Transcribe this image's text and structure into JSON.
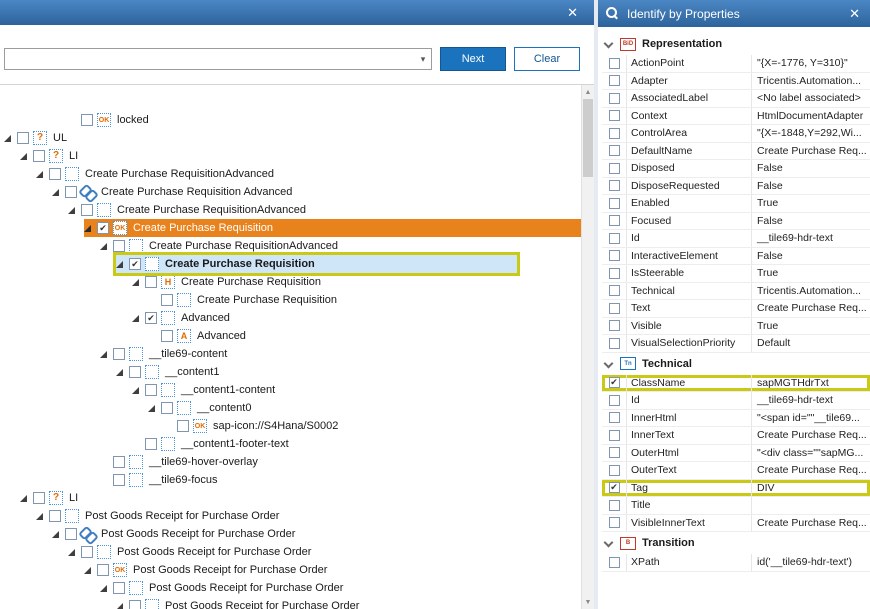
{
  "icons": {
    "close": "✕",
    "combo_arrow": "▾",
    "scroll_up": "▲",
    "scroll_down": "▼"
  },
  "left_panel": {
    "search": {
      "value": "",
      "next_label": "Next",
      "clear_label": "Clear"
    },
    "tree": [
      {
        "indent": 4,
        "arrow": false,
        "checked": false,
        "icon": "ok",
        "label": "locked"
      },
      {
        "indent": 0,
        "arrow": true,
        "checked": false,
        "icon": "question",
        "label": "UL"
      },
      {
        "indent": 1,
        "arrow": true,
        "checked": false,
        "icon": "question",
        "label": "LI"
      },
      {
        "indent": 2,
        "arrow": true,
        "checked": false,
        "icon": "dotted",
        "label": "Create Purchase RequisitionAdvanced"
      },
      {
        "indent": 3,
        "arrow": true,
        "checked": false,
        "icon": "link",
        "label": "Create Purchase Requisition Advanced"
      },
      {
        "indent": 4,
        "arrow": true,
        "checked": false,
        "icon": "dotted",
        "label": "Create Purchase RequisitionAdvanced"
      },
      {
        "indent": 5,
        "arrow": true,
        "checked": true,
        "icon": "ok",
        "label": "Create Purchase Requisition",
        "style": "row-orange"
      },
      {
        "indent": 6,
        "arrow": true,
        "checked": false,
        "icon": "dotted",
        "label": "Create Purchase RequisitionAdvanced"
      },
      {
        "indent": 7,
        "arrow": true,
        "checked": true,
        "icon": "dotted",
        "label": "Create Purchase Requisition",
        "style": "yellow-selected"
      },
      {
        "indent": 8,
        "arrow": true,
        "checked": false,
        "icon": "h",
        "label": "Create Purchase Requisition"
      },
      {
        "indent": 9,
        "arrow": false,
        "checked": false,
        "icon": "dotted",
        "label": "Create Purchase Requisition"
      },
      {
        "indent": 8,
        "arrow": true,
        "checked": true,
        "icon": "dotted",
        "label": "Advanced"
      },
      {
        "indent": 9,
        "arrow": false,
        "checked": false,
        "icon": "a",
        "label": "Advanced"
      },
      {
        "indent": 6,
        "arrow": true,
        "checked": false,
        "icon": "dotted",
        "label": "__tile69-content"
      },
      {
        "indent": 7,
        "arrow": true,
        "checked": false,
        "icon": "dotted",
        "label": "__content1"
      },
      {
        "indent": 8,
        "arrow": true,
        "checked": false,
        "icon": "dotted",
        "label": "__content1-content"
      },
      {
        "indent": 9,
        "arrow": true,
        "checked": false,
        "icon": "dotted",
        "label": "__content0"
      },
      {
        "indent": 10,
        "arrow": false,
        "checked": false,
        "icon": "ok",
        "label": "sap-icon://S4Hana/S0002"
      },
      {
        "indent": 8,
        "arrow": false,
        "checked": false,
        "icon": "dotted",
        "label": "__content1-footer-text"
      },
      {
        "indent": 6,
        "arrow": false,
        "checked": false,
        "icon": "dotted",
        "label": "__tile69-hover-overlay"
      },
      {
        "indent": 6,
        "arrow": false,
        "checked": false,
        "icon": "dotted",
        "label": "__tile69-focus"
      },
      {
        "indent": 1,
        "arrow": true,
        "checked": false,
        "icon": "question",
        "label": "LI"
      },
      {
        "indent": 2,
        "arrow": true,
        "checked": false,
        "icon": "dotted",
        "label": "Post Goods Receipt for Purchase Order"
      },
      {
        "indent": 3,
        "arrow": true,
        "checked": false,
        "icon": "link",
        "label": "Post Goods Receipt for Purchase Order"
      },
      {
        "indent": 4,
        "arrow": true,
        "checked": false,
        "icon": "dotted",
        "label": "Post Goods Receipt for Purchase Order"
      },
      {
        "indent": 5,
        "arrow": true,
        "checked": false,
        "icon": "ok",
        "label": "Post Goods Receipt for Purchase Order"
      },
      {
        "indent": 6,
        "arrow": true,
        "checked": false,
        "icon": "dotted",
        "label": "Post Goods Receipt for Purchase Order"
      },
      {
        "indent": 7,
        "arrow": true,
        "checked": false,
        "icon": "dotted",
        "label": "Post Goods Receipt for Purchase Order"
      }
    ]
  },
  "right_panel": {
    "title": "Identify by Properties",
    "sections": [
      {
        "title": "Representation",
        "icon_text": "BiD",
        "icon_color": "#c0392b",
        "rows": [
          {
            "name": "ActionPoint",
            "value": "\"{X=-1776, Y=310}\"",
            "checked": false
          },
          {
            "name": "Adapter",
            "value": "Tricentis.Automation...",
            "checked": false
          },
          {
            "name": "AssociatedLabel",
            "value": "<No label associated>",
            "checked": false
          },
          {
            "name": "Context",
            "value": "HtmlDocumentAdapter",
            "checked": false
          },
          {
            "name": "ControlArea",
            "value": "\"{X=-1848,Y=292,Wi...",
            "checked": false
          },
          {
            "name": "DefaultName",
            "value": "Create Purchase Req...",
            "checked": false
          },
          {
            "name": "Disposed",
            "value": "False",
            "checked": false
          },
          {
            "name": "DisposeRequested",
            "value": "False",
            "checked": false
          },
          {
            "name": "Enabled",
            "value": "True",
            "checked": false
          },
          {
            "name": "Focused",
            "value": "False",
            "checked": false
          },
          {
            "name": "Id",
            "value": "__tile69-hdr-text",
            "checked": false
          },
          {
            "name": "InteractiveElement",
            "value": "False",
            "checked": false
          },
          {
            "name": "IsSteerable",
            "value": "True",
            "checked": false
          },
          {
            "name": "Technical",
            "value": "Tricentis.Automation...",
            "checked": false
          },
          {
            "name": "Text",
            "value": "Create Purchase Req...",
            "checked": false
          },
          {
            "name": "Visible",
            "value": "True",
            "checked": false
          },
          {
            "name": "VisualSelectionPriority",
            "value": "Default",
            "checked": false
          }
        ]
      },
      {
        "title": "Technical",
        "icon_text": "Tn",
        "icon_color": "#1b72bd",
        "rows": [
          {
            "name": "ClassName",
            "value": "sapMGTHdrTxt",
            "checked": true,
            "highlight": true
          },
          {
            "name": "Id",
            "value": "__tile69-hdr-text",
            "checked": false
          },
          {
            "name": "InnerHtml",
            "value": "\"<span id=\"\"__tile69...",
            "checked": false
          },
          {
            "name": "InnerText",
            "value": "Create Purchase Req...",
            "checked": false
          },
          {
            "name": "OuterHtml",
            "value": "\"<div class=\"\"sapMG...",
            "checked": false
          },
          {
            "name": "OuterText",
            "value": "Create Purchase Req...",
            "checked": false
          },
          {
            "name": "Tag",
            "value": "DIV",
            "checked": true,
            "highlight": true
          },
          {
            "name": "Title",
            "value": "",
            "checked": false
          },
          {
            "name": "VisibleInnerText",
            "value": "Create Purchase Req...",
            "checked": false
          }
        ]
      },
      {
        "title": "Transition",
        "icon_text": "B",
        "icon_color": "#c0392b",
        "rows": [
          {
            "name": "XPath",
            "value": "id('__tile69-hdr-text')",
            "checked": false
          }
        ]
      }
    ]
  }
}
